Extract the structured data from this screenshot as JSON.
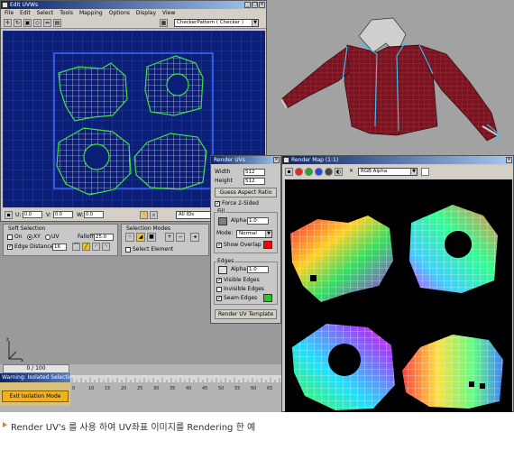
{
  "edit_uvws": {
    "title": "Edit UVWs",
    "menu": [
      "File",
      "Edit",
      "Select",
      "Tools",
      "Mapping",
      "Options",
      "Display",
      "View"
    ],
    "texture_dropdown": "CheckerPattern ( Checker )",
    "coords": {
      "u_label": "U:",
      "v_label": "V:",
      "w_label": "W:",
      "u": "0.0",
      "v": "0.0",
      "w": "0.0"
    },
    "id_dropdown": "All IDs"
  },
  "soft_selection": {
    "title": "Soft Selection",
    "on_label": "On",
    "xy_label": "XY",
    "uv_label": "UV",
    "falloff_label": "Falloff",
    "falloff_value": "25.0",
    "edge_distance_label": "Edge Distance",
    "edge_distance_value": "16"
  },
  "selection_modes": {
    "title": "Selection Modes",
    "select_element_label": "Select Element"
  },
  "render_uvs": {
    "title": "Render UVs",
    "width_label": "Width",
    "width_value": "512",
    "height_label": "Height",
    "height_value": "512",
    "guess_aspect_label": "Guess Aspect Ratio",
    "force_2sided_label": "Force 2-Sided",
    "fill_label": "Fill",
    "alpha_label": "Alpha",
    "fill_alpha_value": "1.0",
    "mode_label": "Mode:",
    "mode_value": "Normal",
    "show_overlap_label": "Show Overlap",
    "edges_label": "Edges",
    "edges_alpha_value": "1.0",
    "visible_edges_label": "Visible Edges",
    "invisible_edges_label": "Invisible Edges",
    "seam_edges_label": "Seam Edges",
    "render_button_label": "Render UV Template",
    "colors": {
      "fill": "#808080",
      "overlap": "#ff0000",
      "seam": "#22cc22"
    }
  },
  "render_map": {
    "title": "Render Map (1:1)",
    "channel_dropdown": "RGB Alpha"
  },
  "timeline": {
    "frame_counter": "0 / 100",
    "isolation_title": "Warning: Isolated Selection",
    "exit_isolation_label": "Exit Isolation Mode",
    "tick_labels": [
      "0",
      "10",
      "15",
      "20",
      "25",
      "30",
      "35",
      "40",
      "45",
      "50",
      "55",
      "60",
      "65"
    ]
  },
  "caption": "Render UV's 를 사용 하여 UV좌표 이미지를 Rendering 한 예"
}
